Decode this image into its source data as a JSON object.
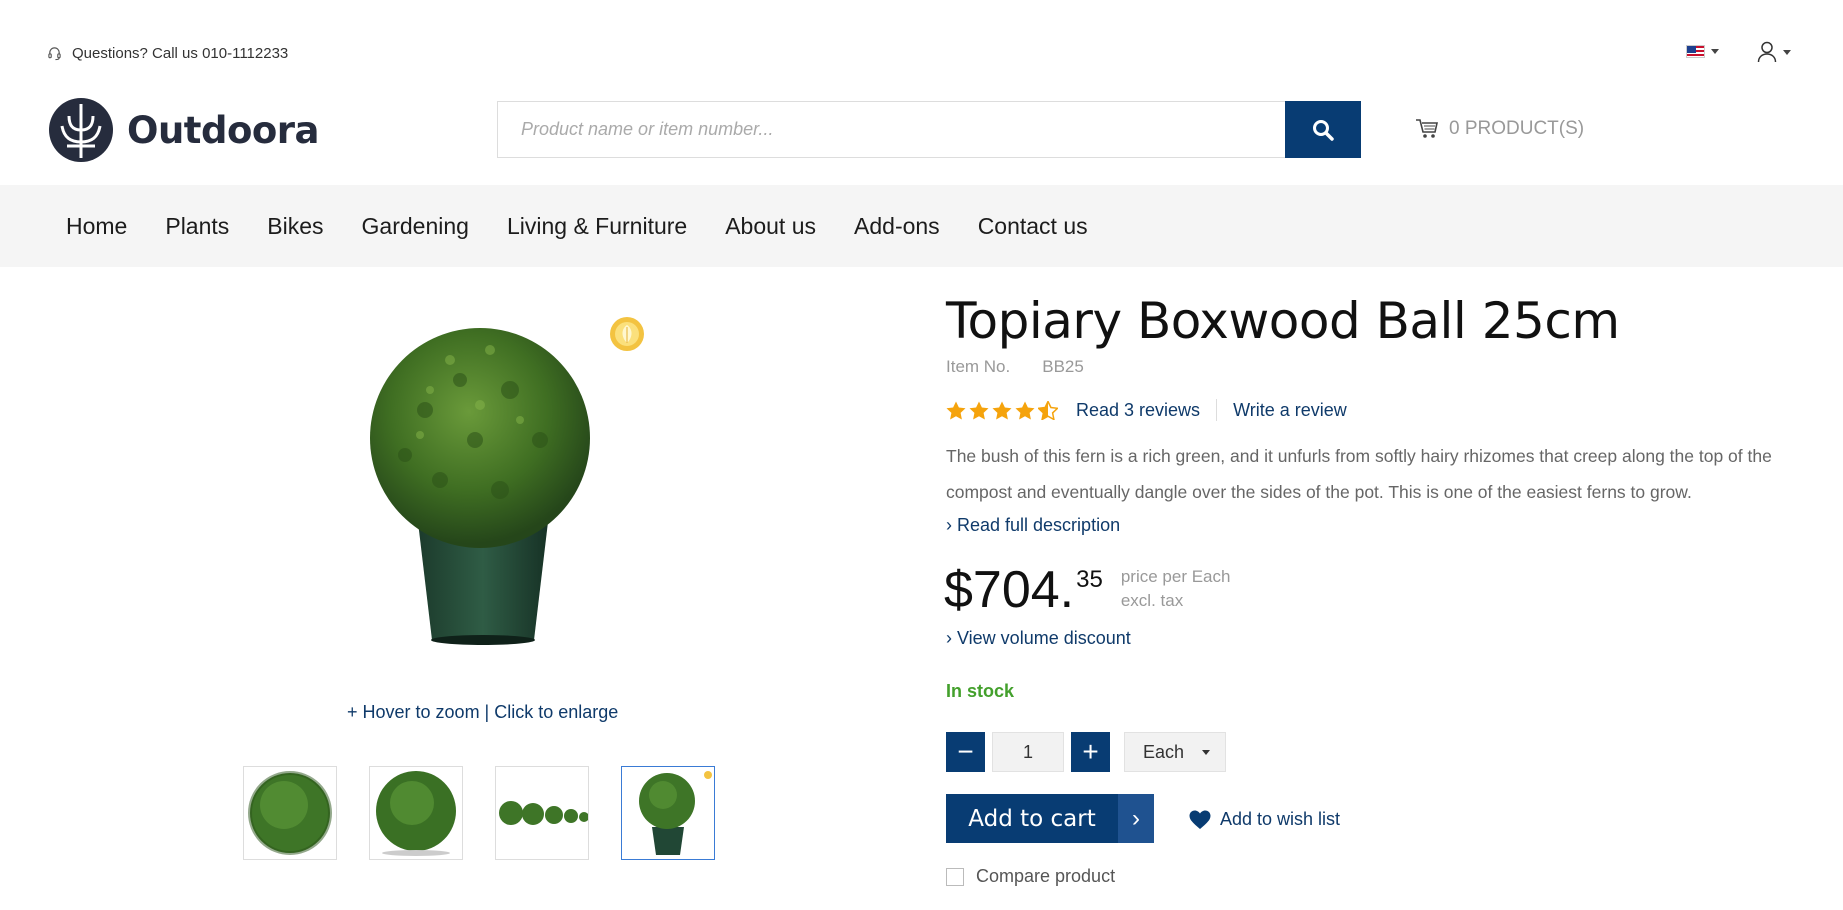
{
  "topbar": {
    "phone_text": "Questions? Call us 010-1112233",
    "language": "en-US",
    "icons": [
      "headset-icon",
      "flag-us-icon",
      "user-icon",
      "chevron-down-icon"
    ]
  },
  "header": {
    "logo_text": "Outdoora",
    "search_placeholder": "Product name or item number...",
    "search_value": "",
    "cart_label": "0 PRODUCT(S)",
    "brand_color": "#083c73"
  },
  "nav": {
    "items": [
      "Home",
      "Plants",
      "Bikes",
      "Gardening",
      "Living & Furniture",
      "About us",
      "Add-ons",
      "Contact us"
    ]
  },
  "gallery": {
    "zoom_hint": "+ Hover to zoom | Click to enlarge",
    "thumbnail_count": 4,
    "active_thumbnail": 4
  },
  "product": {
    "title": "Topiary Boxwood Ball 25cm",
    "item_no_label": "Item No.",
    "item_no_value": "BB25",
    "rating": 4.5,
    "rating_max": 5,
    "read_reviews": "Read 3 reviews",
    "write_review": "Write a review",
    "description": "The bush of this fern is a rich green, and it unfurls from softly hairy rhizomes that creep along the top of the compost and eventually dangle over the sides of the pot. This is one of the easiest ferns to grow.",
    "read_full": "› Read full description",
    "price_main": "$704.",
    "price_cents": "35",
    "price_per": "price per Each",
    "price_tax": "excl. tax",
    "volume_discount": "› View volume discount",
    "stock_status": "In stock",
    "stock_color": "#43a02c",
    "quantity": "1",
    "unit": "Each",
    "minus": "−",
    "plus": "+",
    "add_to_cart": "Add to cart",
    "add_to_cart_arrow": "›",
    "wishlist": "Add to wish list",
    "compare": "Compare product"
  }
}
